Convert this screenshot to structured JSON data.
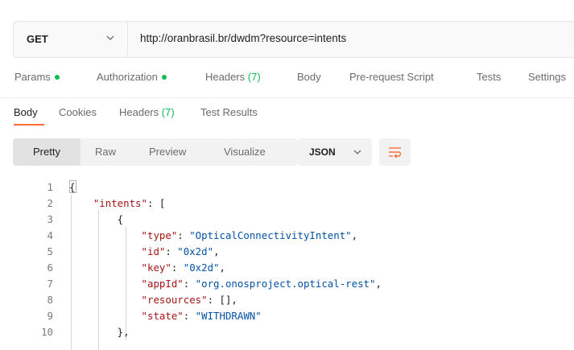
{
  "request": {
    "method": "GET",
    "url": "http://oranbrasil.br/dwdm?resource=intents"
  },
  "request_tabs": [
    {
      "label": "Params",
      "dot": true
    },
    {
      "label": "Authorization",
      "dot": true
    },
    {
      "label": "Headers",
      "count": "(7)"
    },
    {
      "label": "Body"
    },
    {
      "label": "Pre-request Script"
    },
    {
      "label": "Tests"
    },
    {
      "label": "Settings"
    }
  ],
  "response_tabs": [
    {
      "label": "Body",
      "active": true
    },
    {
      "label": "Cookies"
    },
    {
      "label": "Headers",
      "count": "(7)"
    },
    {
      "label": "Test Results"
    }
  ],
  "view_modes": [
    "Pretty",
    "Raw",
    "Preview",
    "Visualize"
  ],
  "active_view": "Pretty",
  "format": "JSON",
  "icons": {
    "method_dropdown": "chevron-down-icon",
    "format_dropdown": "chevron-down-icon",
    "wrap": "word-wrap-icon"
  },
  "colors": {
    "accent": "#ff6c37",
    "status_dot": "#0cbb52",
    "json_key": "#a31515",
    "json_string": "#0451a5"
  },
  "code_lines": [
    {
      "num": "1",
      "tokens": [
        {
          "t": "{",
          "c": "punc"
        }
      ]
    },
    {
      "num": "2",
      "tokens": [
        {
          "t": "    ",
          "c": "punc"
        },
        {
          "t": "\"intents\"",
          "c": "key"
        },
        {
          "t": ": [",
          "c": "punc"
        }
      ]
    },
    {
      "num": "3",
      "tokens": [
        {
          "t": "        {",
          "c": "punc"
        }
      ]
    },
    {
      "num": "4",
      "tokens": [
        {
          "t": "            ",
          "c": "punc"
        },
        {
          "t": "\"type\"",
          "c": "key"
        },
        {
          "t": ": ",
          "c": "punc"
        },
        {
          "t": "\"OpticalConnectivityIntent\"",
          "c": "str"
        },
        {
          "t": ",",
          "c": "punc"
        }
      ]
    },
    {
      "num": "5",
      "tokens": [
        {
          "t": "            ",
          "c": "punc"
        },
        {
          "t": "\"id\"",
          "c": "key"
        },
        {
          "t": ": ",
          "c": "punc"
        },
        {
          "t": "\"0x2d\"",
          "c": "str"
        },
        {
          "t": ",",
          "c": "punc"
        }
      ]
    },
    {
      "num": "6",
      "tokens": [
        {
          "t": "            ",
          "c": "punc"
        },
        {
          "t": "\"key\"",
          "c": "key"
        },
        {
          "t": ": ",
          "c": "punc"
        },
        {
          "t": "\"0x2d\"",
          "c": "str"
        },
        {
          "t": ",",
          "c": "punc"
        }
      ]
    },
    {
      "num": "7",
      "tokens": [
        {
          "t": "            ",
          "c": "punc"
        },
        {
          "t": "\"appId\"",
          "c": "key"
        },
        {
          "t": ": ",
          "c": "punc"
        },
        {
          "t": "\"org.onosproject.optical-rest\"",
          "c": "str"
        },
        {
          "t": ",",
          "c": "punc"
        }
      ]
    },
    {
      "num": "8",
      "tokens": [
        {
          "t": "            ",
          "c": "punc"
        },
        {
          "t": "\"resources\"",
          "c": "key"
        },
        {
          "t": ": [],",
          "c": "punc"
        }
      ]
    },
    {
      "num": "9",
      "tokens": [
        {
          "t": "            ",
          "c": "punc"
        },
        {
          "t": "\"state\"",
          "c": "key"
        },
        {
          "t": ": ",
          "c": "punc"
        },
        {
          "t": "\"WITHDRAWN\"",
          "c": "str"
        }
      ]
    },
    {
      "num": "10",
      "tokens": [
        {
          "t": "        },",
          "c": "punc"
        }
      ]
    }
  ]
}
